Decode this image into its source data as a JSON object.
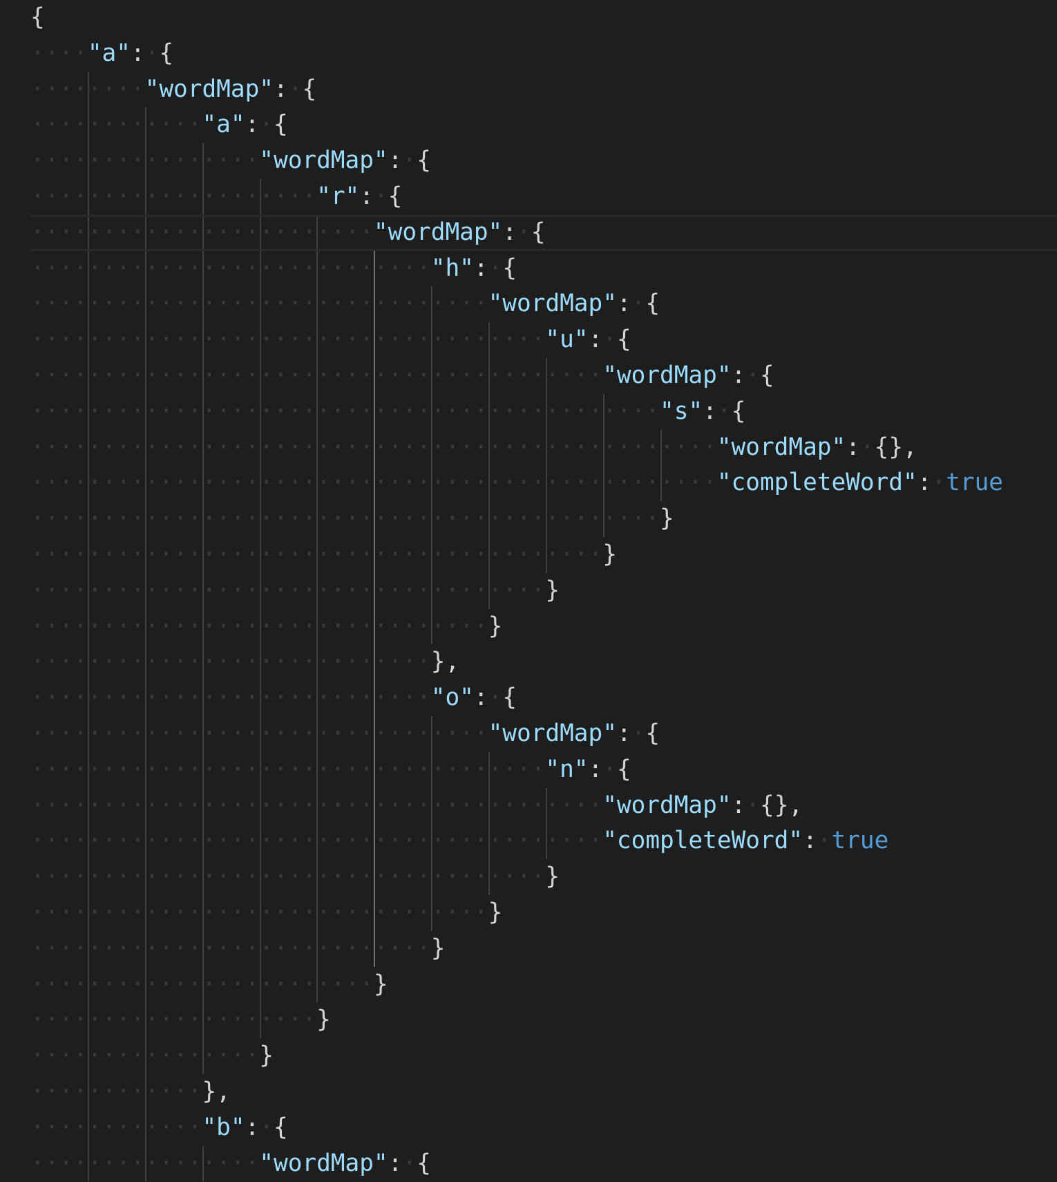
{
  "editor": {
    "language": "json",
    "current_line": 6,
    "active_guide_level": 6,
    "colors": {
      "background": "#1e1e1e",
      "key": "#9cdcfe",
      "punctuation": "#d4d4d4",
      "boolean": "#569cd6",
      "whitespace": "#3a3a3a",
      "guide": "#404040"
    },
    "lines": [
      {
        "indent": 0,
        "key": null,
        "value": "{"
      },
      {
        "indent": 4,
        "key": "\"a\"",
        "value": "{"
      },
      {
        "indent": 8,
        "key": "\"wordMap\"",
        "value": "{"
      },
      {
        "indent": 12,
        "key": "\"a\"",
        "value": "{"
      },
      {
        "indent": 16,
        "key": "\"wordMap\"",
        "value": "{"
      },
      {
        "indent": 20,
        "key": "\"r\"",
        "value": "{"
      },
      {
        "indent": 24,
        "key": "\"wordMap\"",
        "value": "{"
      },
      {
        "indent": 28,
        "key": "\"h\"",
        "value": "{"
      },
      {
        "indent": 32,
        "key": "\"wordMap\"",
        "value": "{"
      },
      {
        "indent": 36,
        "key": "\"u\"",
        "value": "{"
      },
      {
        "indent": 40,
        "key": "\"wordMap\"",
        "value": "{"
      },
      {
        "indent": 44,
        "key": "\"s\"",
        "value": "{"
      },
      {
        "indent": 48,
        "key": "\"wordMap\"",
        "value": "{},"
      },
      {
        "indent": 48,
        "key": "\"completeWord\"",
        "value": "true"
      },
      {
        "indent": 44,
        "key": null,
        "value": "}"
      },
      {
        "indent": 40,
        "key": null,
        "value": "}"
      },
      {
        "indent": 36,
        "key": null,
        "value": "}"
      },
      {
        "indent": 32,
        "key": null,
        "value": "}"
      },
      {
        "indent": 28,
        "key": null,
        "value": "},"
      },
      {
        "indent": 28,
        "key": "\"o\"",
        "value": "{"
      },
      {
        "indent": 32,
        "key": "\"wordMap\"",
        "value": "{"
      },
      {
        "indent": 36,
        "key": "\"n\"",
        "value": "{"
      },
      {
        "indent": 40,
        "key": "\"wordMap\"",
        "value": "{},"
      },
      {
        "indent": 40,
        "key": "\"completeWord\"",
        "value": "true"
      },
      {
        "indent": 36,
        "key": null,
        "value": "}"
      },
      {
        "indent": 32,
        "key": null,
        "value": "}"
      },
      {
        "indent": 28,
        "key": null,
        "value": "}"
      },
      {
        "indent": 24,
        "key": null,
        "value": "}"
      },
      {
        "indent": 20,
        "key": null,
        "value": "}"
      },
      {
        "indent": 16,
        "key": null,
        "value": "}"
      },
      {
        "indent": 12,
        "key": null,
        "value": "},"
      },
      {
        "indent": 12,
        "key": "\"b\"",
        "value": "{"
      },
      {
        "indent": 16,
        "key": "\"wordMap\"",
        "value": "{"
      }
    ]
  }
}
